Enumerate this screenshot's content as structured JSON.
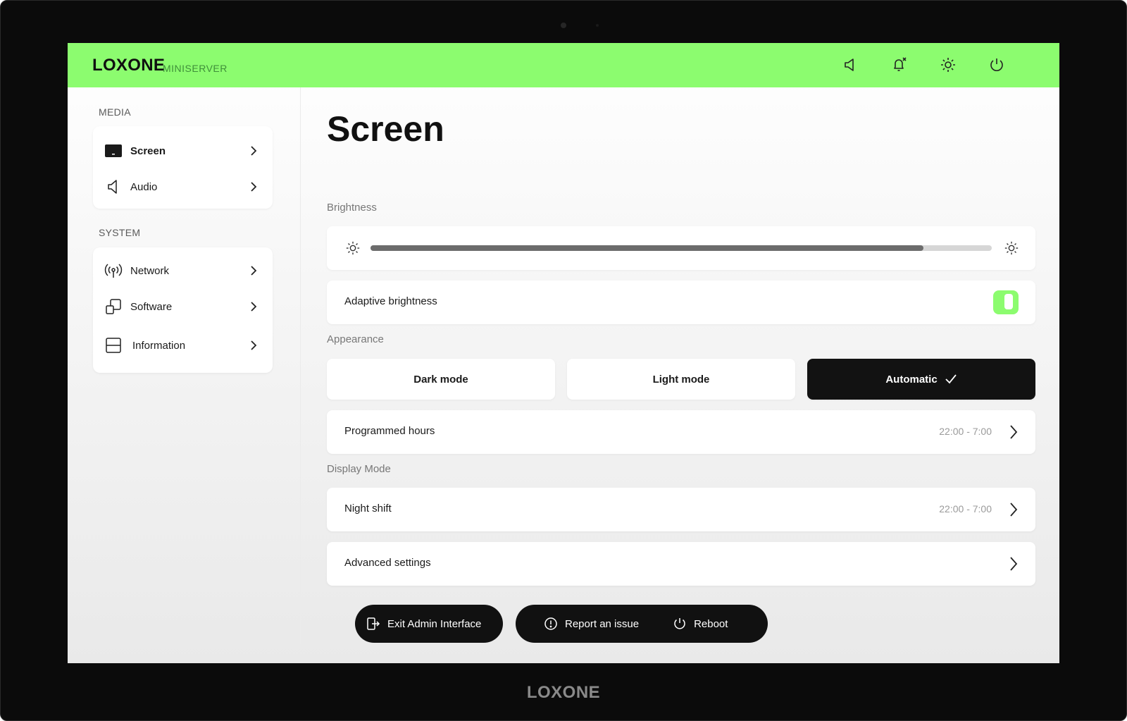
{
  "header": {
    "logo": "LOXONE",
    "subtitle": "MINISERVER",
    "icons": [
      "speaker-icon",
      "bell-off-icon",
      "brightness-icon",
      "power-icon"
    ],
    "accent_color": "#8cfc6f"
  },
  "sidebar": {
    "media_label": "MEDIA",
    "system_label": "SYSTEM",
    "media_items": [
      {
        "label": "Screen",
        "icon": "screen-icon",
        "active": true
      },
      {
        "label": "Audio",
        "icon": "speaker-icon"
      }
    ],
    "system_items": [
      {
        "label": "Network",
        "icon": "antenna-icon"
      },
      {
        "label": "Software",
        "icon": "software-icon"
      },
      {
        "label": "Information",
        "icon": "information-icon"
      }
    ]
  },
  "main": {
    "title": "Screen",
    "brightness": {
      "label": "Brightness",
      "value_fraction": 0.89
    },
    "adaptive_brightness": {
      "label": "Adaptive brightness",
      "enabled": true
    },
    "appearance": {
      "label": "Appearance",
      "options": [
        "Dark mode",
        "Light mode",
        "Automatic"
      ],
      "selected": "Automatic"
    },
    "programmed_hours": {
      "label": "Programmed hours",
      "value": "22:00 - 7:00"
    },
    "display_mode": {
      "label": "Display Mode"
    },
    "night_shift": {
      "label": "Night shift",
      "value": "22:00 - 7:00"
    },
    "advanced": {
      "label": "Advanced settings"
    }
  },
  "footer": {
    "exit_label": "Exit Admin Interface",
    "report_label": "Report an issue",
    "reboot_label": "Reboot"
  },
  "device": {
    "bezel_logo": "LOXONE"
  }
}
